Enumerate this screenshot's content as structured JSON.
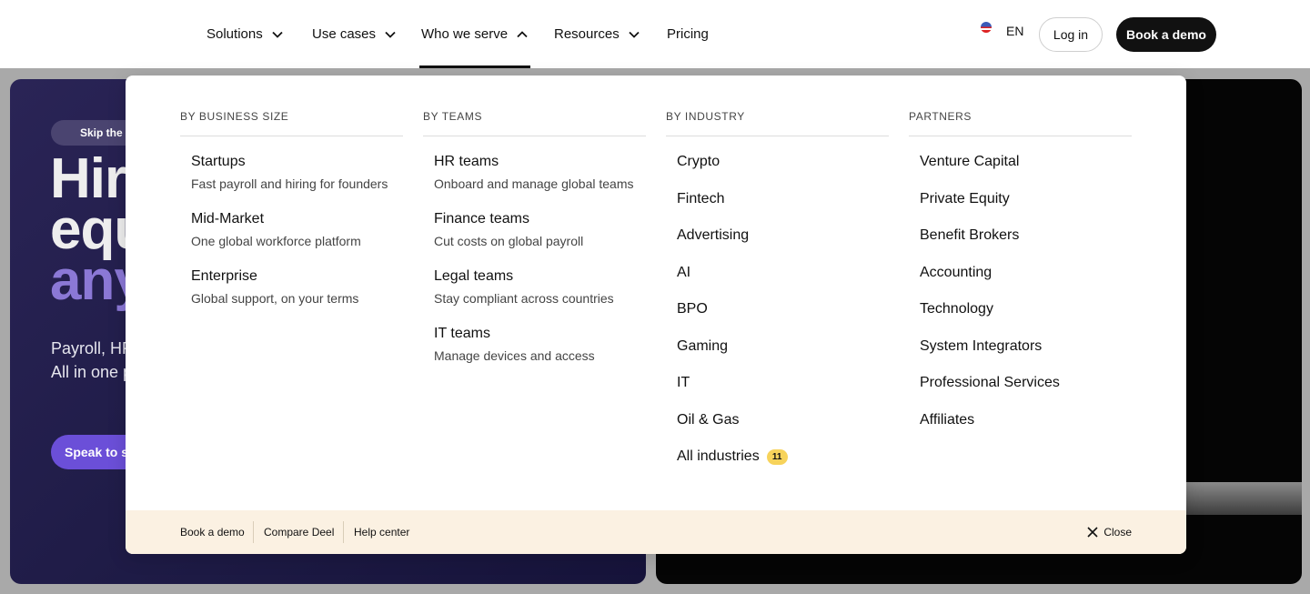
{
  "header": {
    "nav": [
      {
        "label": "Solutions",
        "has_chevron": true,
        "expanded": false
      },
      {
        "label": "Use cases",
        "has_chevron": true,
        "expanded": false
      },
      {
        "label": "Who we serve",
        "has_chevron": true,
        "expanded": true
      },
      {
        "label": "Resources",
        "has_chevron": true,
        "expanded": false
      },
      {
        "label": "Pricing",
        "has_chevron": false,
        "expanded": false
      }
    ],
    "language": "EN",
    "flag_icon": "us-flag-icon",
    "login_label": "Log in",
    "demo_label": "Book a demo"
  },
  "hero": {
    "skip_label": "Skip the s",
    "headline_line1": "Hire",
    "headline_line2": "equ",
    "headline_line3": "any",
    "sub_line1": "Payroll, HR",
    "sub_line2": "All in one p",
    "cta_label": "Speak to sa",
    "accent_color": "#8b78d6"
  },
  "menu": {
    "columns": [
      {
        "heading": "BY BUSINESS SIZE",
        "items": [
          {
            "title": "Startups",
            "desc": "Fast payroll and hiring for founders"
          },
          {
            "title": "Mid-Market",
            "desc": "One global workforce platform"
          },
          {
            "title": "Enterprise",
            "desc": "Global support, on your terms"
          }
        ]
      },
      {
        "heading": "BY TEAMS",
        "items": [
          {
            "title": "HR teams",
            "desc": "Onboard and manage global teams"
          },
          {
            "title": "Finance teams",
            "desc": "Cut costs on global payroll"
          },
          {
            "title": "Legal teams",
            "desc": "Stay compliant across countries"
          },
          {
            "title": "IT teams",
            "desc": "Manage devices and access"
          }
        ]
      },
      {
        "heading": "BY INDUSTRY",
        "items": [
          {
            "title": "Crypto"
          },
          {
            "title": "Fintech"
          },
          {
            "title": "Advertising"
          },
          {
            "title": "AI"
          },
          {
            "title": "BPO"
          },
          {
            "title": "Gaming"
          },
          {
            "title": "IT"
          },
          {
            "title": "Oil & Gas"
          },
          {
            "title": "All industries",
            "badge": "11"
          }
        ]
      },
      {
        "heading": "PARTNERS",
        "items": [
          {
            "title": "Venture Capital"
          },
          {
            "title": "Private Equity"
          },
          {
            "title": "Benefit Brokers"
          },
          {
            "title": "Accounting"
          },
          {
            "title": "Technology"
          },
          {
            "title": "System Integrators"
          },
          {
            "title": "Professional Services"
          },
          {
            "title": "Affiliates"
          }
        ]
      }
    ],
    "footer": {
      "links": [
        "Book a demo",
        "Compare Deel",
        "Help center"
      ],
      "close_label": "Close",
      "background": "#fbf1e2"
    },
    "badge_color": "#f7d35b"
  }
}
